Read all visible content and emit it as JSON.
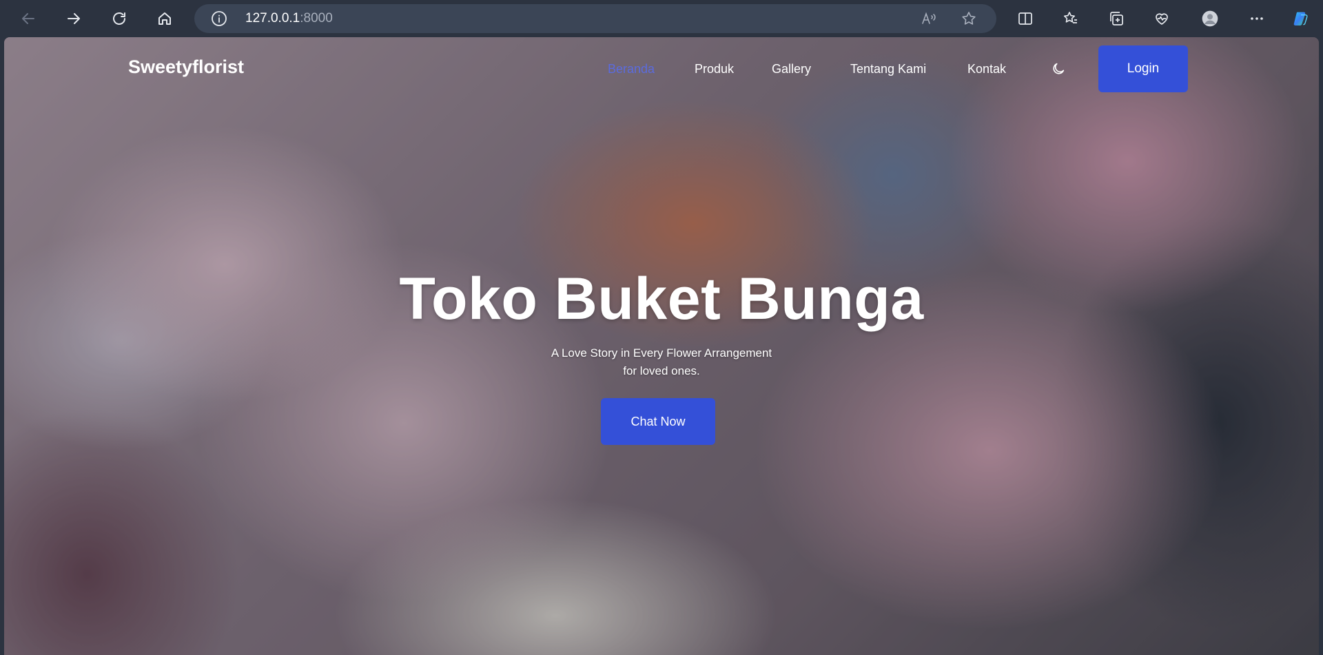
{
  "browser": {
    "address_host": "127.0.0.1",
    "address_port": ":8000",
    "icons": {
      "back": "back-arrow-icon",
      "forward": "forward-arrow-icon",
      "reload": "reload-icon",
      "home": "home-icon",
      "site_info": "info-icon",
      "read_aloud": "read-aloud-icon",
      "favorite": "star-icon",
      "split_screen": "split-screen-icon",
      "favorites": "favorites-icon",
      "collections": "collections-icon",
      "browser_essentials": "heart-pulse-icon",
      "profile": "avatar-icon",
      "more": "more-icon",
      "copilot": "copilot-icon"
    }
  },
  "site": {
    "brand": "Sweetyflorist",
    "nav": {
      "home": "Beranda",
      "products": "Produk",
      "gallery": "Gallery",
      "about": "Tentang Kami",
      "contact": "Kontak"
    },
    "login_label": "Login",
    "accent_color": "#3450d8",
    "active_link_color": "#5b6bde"
  },
  "hero": {
    "title": "Toko Buket Bunga",
    "subtitle_line1": "A Love Story in Every Flower Arrangement",
    "subtitle_line2": "for loved ones.",
    "cta_label": "Chat Now"
  }
}
